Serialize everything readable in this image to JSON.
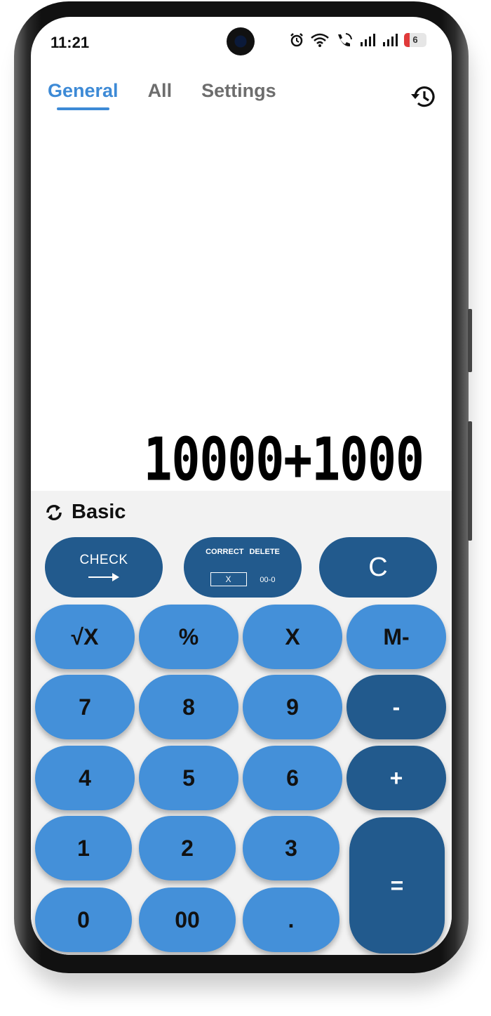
{
  "status_bar": {
    "time": "11:21",
    "battery": "6"
  },
  "tabs": [
    {
      "label": "General",
      "active": true
    },
    {
      "label": "All",
      "active": false
    },
    {
      "label": "Settings",
      "active": false
    }
  ],
  "display": {
    "expression": "10000+1000"
  },
  "mode": {
    "label": "Basic"
  },
  "top_keys": {
    "check": "CHECK",
    "correct": "CORRECT",
    "delete": "DELETE",
    "correct_box": "X",
    "delete_sample": "00-0",
    "clear": "C"
  },
  "keys": {
    "sqrt": "√X",
    "percent": "%",
    "multiply": "X",
    "mminus": "M-",
    "seven": "7",
    "eight": "8",
    "nine": "9",
    "minus": "-",
    "four": "4",
    "five": "5",
    "six": "6",
    "plus": "+",
    "one": "1",
    "two": "2",
    "three": "3",
    "equals": "=",
    "zero": "0",
    "double_zero": "00",
    "dot": "."
  },
  "colors": {
    "accent": "#3d8ad6",
    "key_light": "#4490d9",
    "key_dark": "#225a8d",
    "keypad_bg": "#f2f2f2"
  }
}
